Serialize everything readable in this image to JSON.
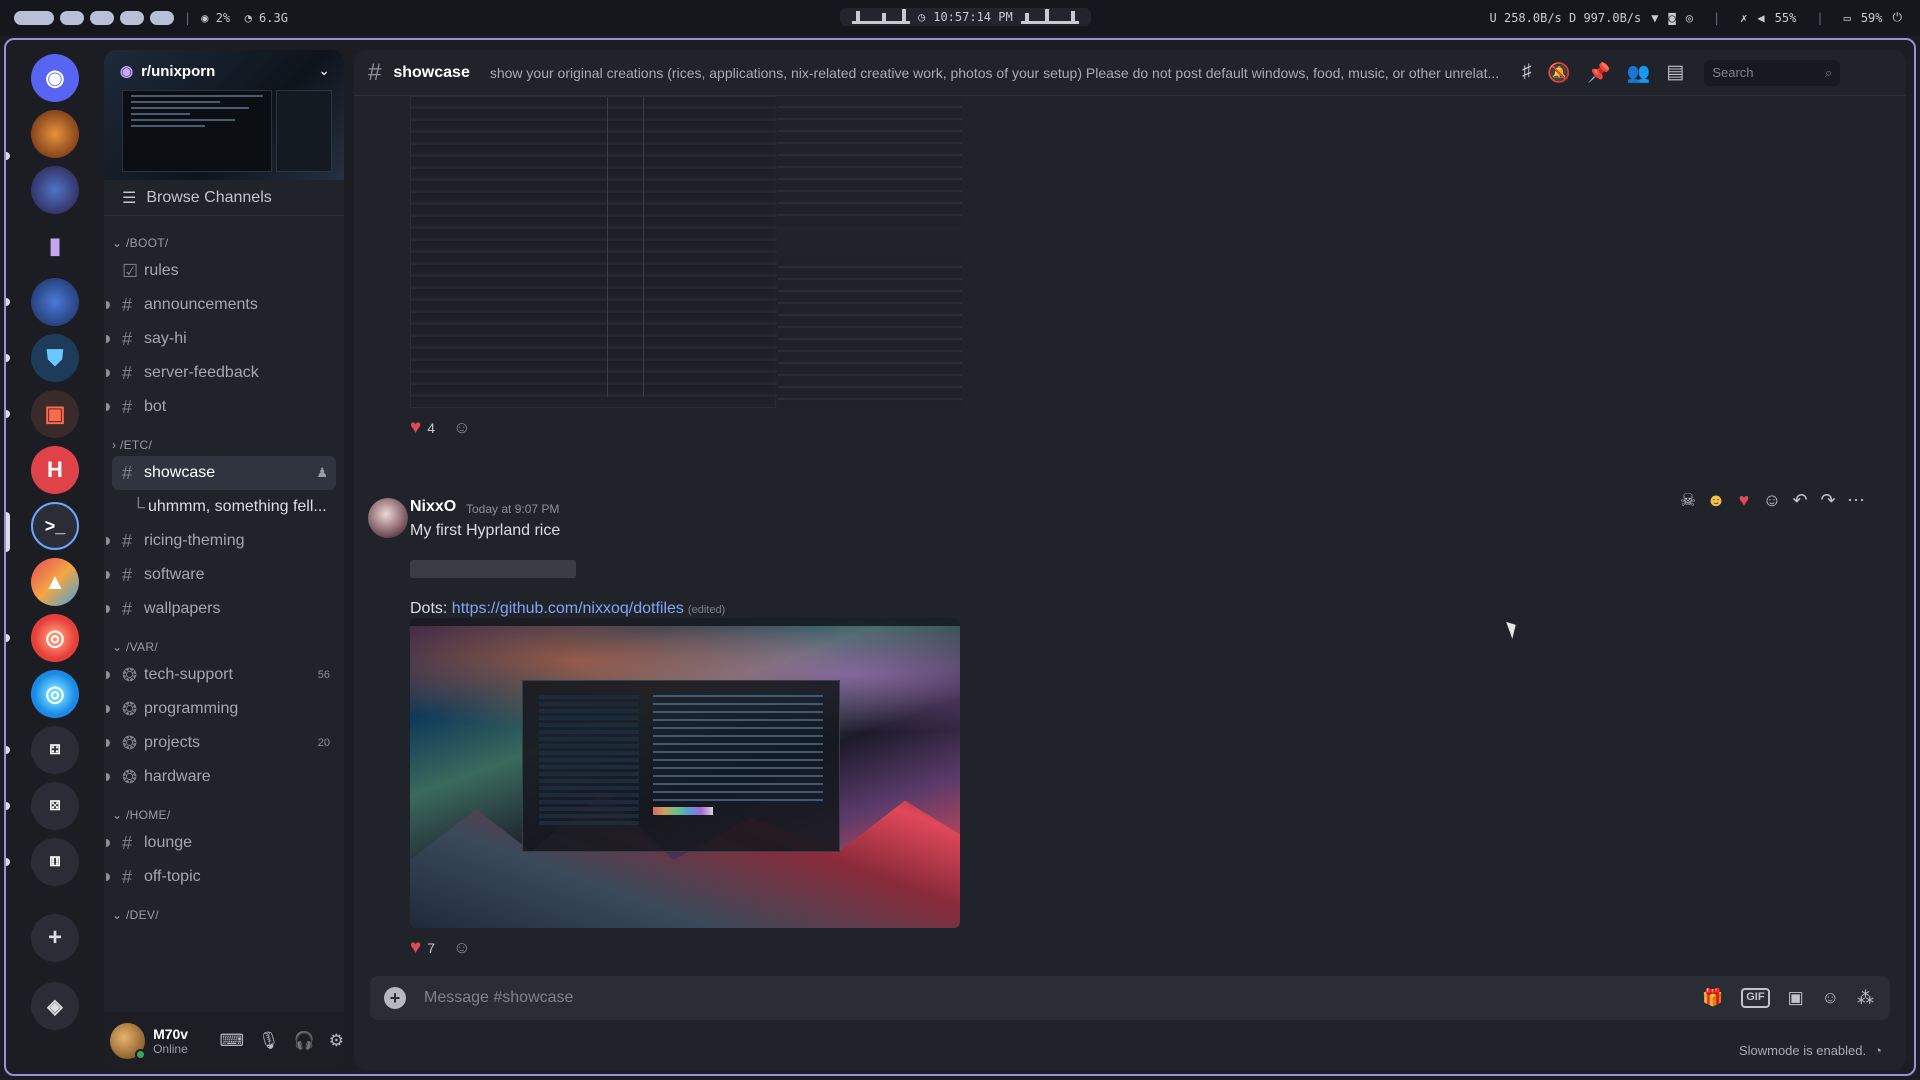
{
  "topbar": {
    "cpu": "2%",
    "mem": "6.3G",
    "clock": "10:57:14 PM",
    "net": "U 258.0B/s D 997.0B/s",
    "volume": "55%",
    "battery": "59%"
  },
  "server": {
    "name": "r/unixporn",
    "browse_label": "Browse Channels"
  },
  "categories": {
    "boot": "/BOOT/",
    "etc": "/ETC/",
    "var": "/VAR/",
    "home": "/HOME/",
    "dev": "/DEV/"
  },
  "channels": {
    "rules": "rules",
    "announcements": "announcements",
    "say_hi": "say-hi",
    "server_feedback": "server-feedback",
    "bot": "bot",
    "showcase": "showcase",
    "thread": "uhmmm, something fell...",
    "ricing": "ricing-theming",
    "software": "software",
    "wallpapers": "wallpapers",
    "tech_support": "tech-support",
    "tech_support_count": "56",
    "programming": "programming",
    "projects": "projects",
    "projects_count": "20",
    "hardware": "hardware",
    "lounge": "lounge",
    "off_topic": "off-topic"
  },
  "user": {
    "name": "M70v",
    "status": "Online"
  },
  "header": {
    "channel": "showcase",
    "topic": "show your original creations (rices, applications, nix-related creative work, photos of your setup) Please do not post default windows, food, music, or other unrelat...",
    "search_placeholder": "Search"
  },
  "messages": {
    "prev_reaction_count": "4",
    "author": "NixxO",
    "timestamp": "Today at 9:07 PM",
    "text": "My first Hyprland rice",
    "dots_label": "Dots: ",
    "dots_link": "https://github.com/nixxoq/dotfiles",
    "edited": "(edited)",
    "reaction_count": "7"
  },
  "composer": {
    "placeholder": "Message #showcase",
    "gif_label": "GIF",
    "slowmode": "Slowmode is enabled."
  },
  "colors": {
    "accent_border": "#9a8fd6",
    "link": "#7fa6f2",
    "heart": "#e04757",
    "online": "#3ba55d"
  }
}
